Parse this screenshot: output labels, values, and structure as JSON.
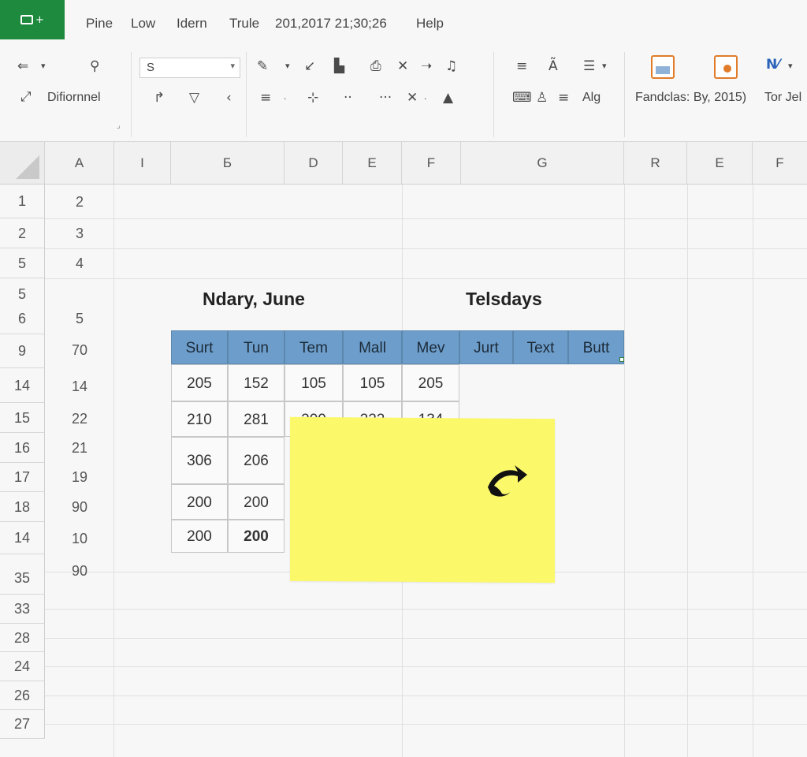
{
  "menu": {
    "items": [
      "Pine",
      "Low",
      "Idern",
      "Trule",
      "201,2017 21;30;26",
      "Help"
    ]
  },
  "ribbon": {
    "font_name": "S",
    "style_label": "Difiornnel",
    "align_label": "Alg",
    "panel_label_1": "Fandclas: By, 2015)",
    "panel_label_2": "Tor Jel",
    "accent_colors": {
      "logo_green": "#1e8a3e",
      "table_header": "#6d9ecb",
      "sticky_note": "#fbf86a"
    }
  },
  "columns": [
    "A",
    "I",
    "Б",
    "D",
    "E",
    "F",
    "G",
    "R",
    "E",
    "F"
  ],
  "rows": [
    {
      "num": "1",
      "a": "2"
    },
    {
      "num": "2",
      "a": "3"
    },
    {
      "num": "5",
      "a": "4"
    },
    {
      "num": "5",
      "a": ""
    },
    {
      "num": "6",
      "a": "5"
    },
    {
      "num": "9",
      "a": "70"
    },
    {
      "num": "14",
      "a": "14"
    },
    {
      "num": "15",
      "a": "22"
    },
    {
      "num": "16",
      "a": "21"
    },
    {
      "num": "17",
      "a": "19"
    },
    {
      "num": "18",
      "a": "90"
    },
    {
      "num": "14",
      "a": "10"
    },
    {
      "num": "35",
      "a": "90"
    },
    {
      "num": "33",
      "a": ""
    },
    {
      "num": "28",
      "a": ""
    },
    {
      "num": "24",
      "a": ""
    },
    {
      "num": "26",
      "a": ""
    },
    {
      "num": "27",
      "a": ""
    }
  ],
  "headings": {
    "left": "Ndary, June",
    "right": "Telsdays"
  },
  "table": {
    "headers": [
      "Surt",
      "Tun",
      "Tem",
      "Mall",
      "Mev",
      "Jurt",
      "Text",
      "Butt"
    ],
    "rows": [
      [
        "205",
        "152",
        "105",
        "105",
        "205"
      ],
      [
        "210",
        "281",
        "200",
        "222",
        "134"
      ],
      [
        "306",
        "206"
      ],
      [
        "200",
        "200"
      ],
      [
        "200",
        "200"
      ]
    ]
  }
}
